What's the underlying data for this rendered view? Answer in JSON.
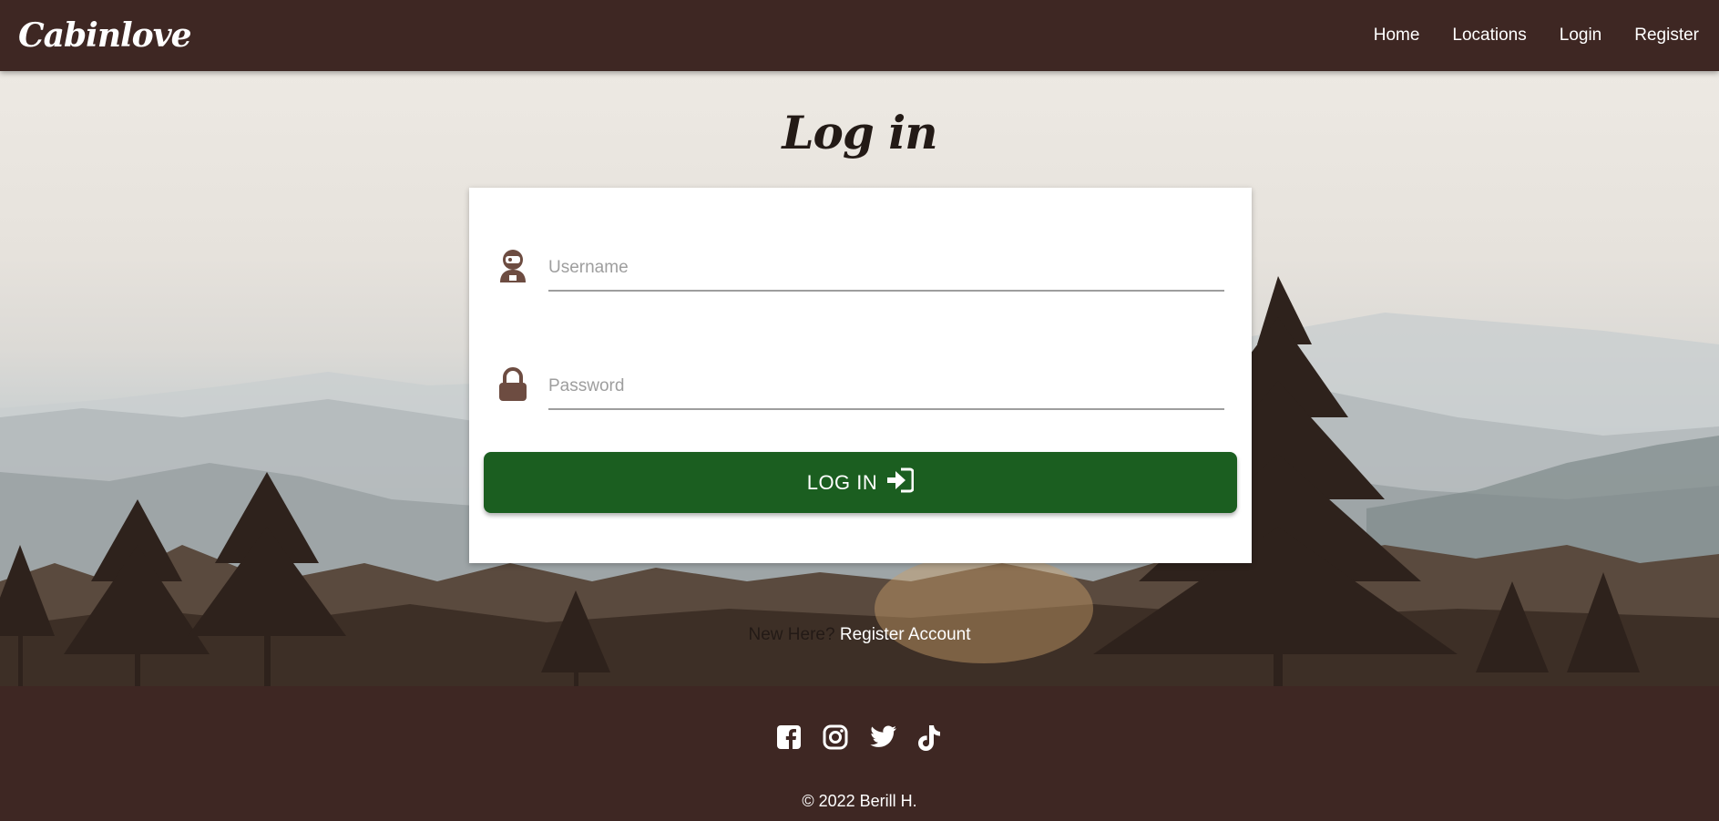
{
  "brand": "Cabinlove",
  "nav": {
    "items": [
      {
        "label": "Home"
      },
      {
        "label": "Locations"
      },
      {
        "label": "Login"
      },
      {
        "label": "Register"
      }
    ]
  },
  "page": {
    "title": "Log in"
  },
  "form": {
    "username": {
      "placeholder": "Username",
      "value": "",
      "icon": "user-astronaut-icon"
    },
    "password": {
      "placeholder": "Password",
      "value": "",
      "icon": "lock-icon"
    },
    "submit_label": "LOG IN",
    "submit_icon": "sign-in-icon"
  },
  "register": {
    "question": "New Here?",
    "link_label": "Register Account"
  },
  "footer": {
    "socials": [
      "facebook-icon",
      "instagram-icon",
      "twitter-icon",
      "tiktok-icon"
    ],
    "copyright": "© 2022 Berill H."
  },
  "colors": {
    "brand_brown": "#3e2723",
    "button_green": "#1b5e20",
    "icon_brown": "#6d4c41"
  }
}
